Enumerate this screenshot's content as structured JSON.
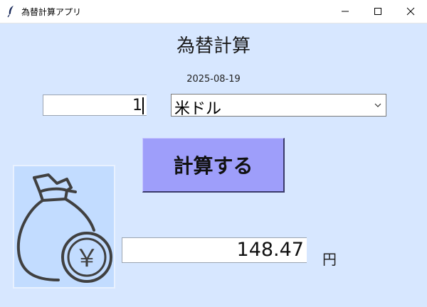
{
  "window": {
    "title": "為替計算アプリ"
  },
  "app": {
    "heading": "為替計算",
    "date": "2025-08-19"
  },
  "form": {
    "amount_value": "1",
    "currency_selected": "米ドル",
    "calculate_label": "計算する"
  },
  "result": {
    "value": "148.47",
    "unit": "円"
  },
  "illustration": {
    "symbol": "￥"
  },
  "colors": {
    "background": "#d7e7ff",
    "button": "#9e9efa",
    "illustration_bg": "#c2dcff"
  }
}
